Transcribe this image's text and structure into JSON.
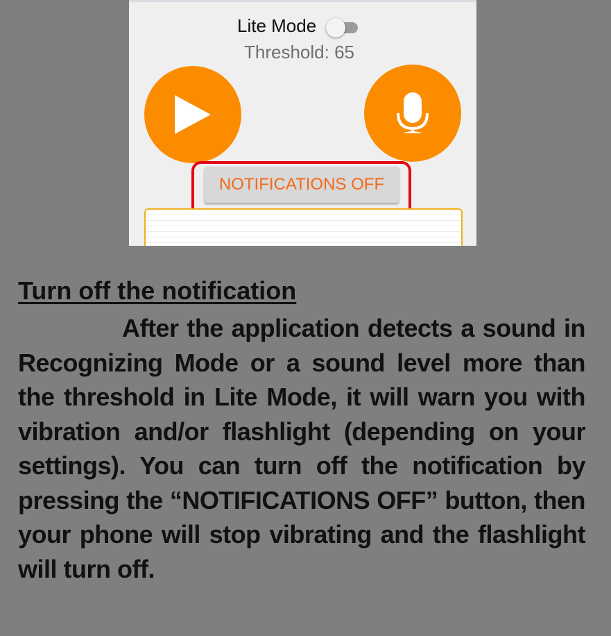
{
  "app": {
    "lite_mode_label": "Lite Mode",
    "lite_mode_on": false,
    "threshold_text": "Threshold: 65",
    "play_icon": "play-icon",
    "mic_icon": "microphone-icon",
    "notifications_button_label": "NOTIFICATIONS OFF",
    "colors": {
      "accent": "#fb8c00",
      "button_text": "#f06a1a",
      "highlight": "#e30613",
      "panel_border": "#f2b01e"
    }
  },
  "guide": {
    "heading": "Turn off the notification",
    "paragraph": "After the application detects a sound in Recognizing Mode or a sound level more than the threshold in Lite Mode, it will warn you with vibration and/or flashlight (depending on your settings). You can turn off the notification by pressing the “NOTIFICATIONS OFF” button, then your phone will stop vibrating and the flashlight will turn off."
  }
}
